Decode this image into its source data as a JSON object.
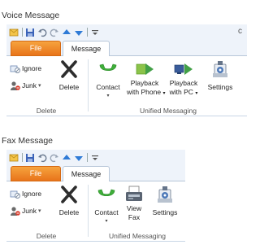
{
  "voice": {
    "caption": "Voice Message",
    "qat_overflow": "c",
    "tabs": {
      "file": "File",
      "message": "Message"
    },
    "groups": {
      "delete": {
        "label": "Delete",
        "ignore": "Ignore",
        "junk": "Junk",
        "delete_btn": "Delete"
      },
      "unified": {
        "label": "Unified Messaging",
        "contact": "Contact",
        "playback_phone_1": "Playback",
        "playback_phone_2": "with Phone",
        "playback_pc_1": "Playback",
        "playback_pc_2": "with PC",
        "settings": "Settings"
      }
    }
  },
  "fax": {
    "caption": "Fax Message",
    "tabs": {
      "file": "File",
      "message": "Message"
    },
    "groups": {
      "delete": {
        "label": "Delete",
        "ignore": "Ignore",
        "junk": "Junk",
        "delete_btn": "Delete"
      },
      "unified": {
        "label": "Unified Messaging",
        "contact": "Contact",
        "view_fax_1": "View",
        "view_fax_2": "Fax",
        "settings": "Settings"
      }
    }
  },
  "dropdown_glyph": "▾",
  "colors": {
    "file_tab": "#e8741a",
    "chrome": "#eef3fa",
    "border": "#b8c7d9"
  }
}
